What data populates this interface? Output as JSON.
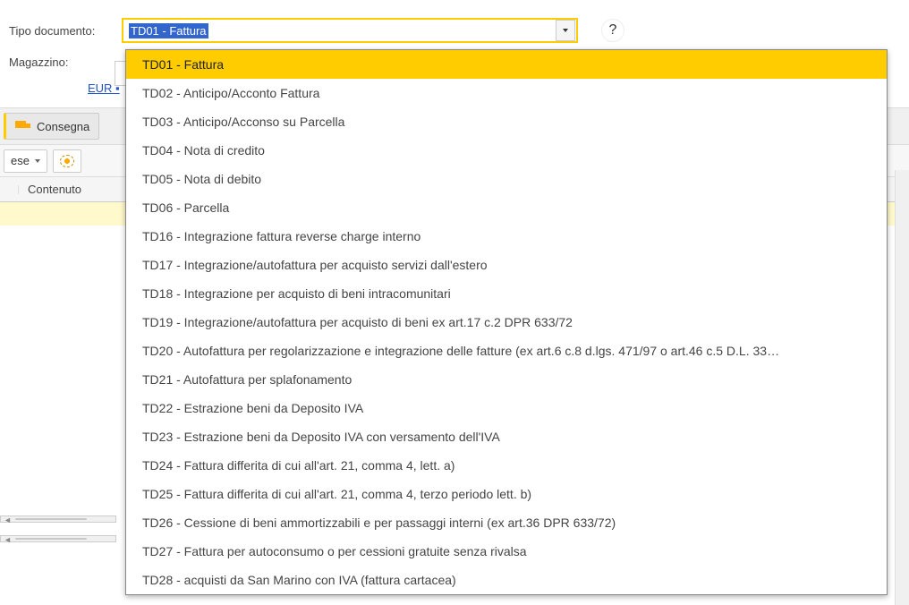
{
  "form": {
    "tipo_documento_label": "Tipo documento:",
    "tipo_documento_value": "TD01 - Fattura",
    "magazzino_label": "Magazzino:",
    "currency_link": "EUR ▪",
    "help_text": "?"
  },
  "toolbar": {
    "consegna_label": "Consegna",
    "ese_label": "ese"
  },
  "grid": {
    "col_contenuto": "Contenuto"
  },
  "dropdown": {
    "items": [
      "TD01 - Fattura",
      "TD02 - Anticipo/Acconto Fattura",
      "TD03 - Anticipo/Acconso su Parcella",
      "TD04 - Nota di credito",
      "TD05 - Nota di debito",
      "TD06 - Parcella",
      "TD16 - Integrazione fattura reverse charge interno",
      "TD17 - Integrazione/autofattura per acquisto servizi dall'estero",
      "TD18 - Integrazione per acquisto di beni intracomunitari",
      "TD19 - Integrazione/autofattura per acquisto di beni ex art.17 c.2 DPR 633/72",
      "TD20 - Autofattura per regolarizzazione e integrazione delle fatture (ex art.6 c.8 d.lgs. 471/97  o  art.46 c.5 D.L. 33…",
      "TD21 - Autofattura per splafonamento",
      "TD22 - Estrazione beni da Deposito IVA",
      "TD23 - Estrazione beni da Deposito IVA con versamento dell'IVA",
      "TD24 - Fattura differita di cui all'art. 21, comma 4, lett. a)",
      "TD25 - Fattura differita di cui all'art. 21, comma 4, terzo periodo lett. b)",
      "TD26 - Cessione di beni ammortizzabili e per passaggi interni (ex art.36 DPR 633/72)",
      "TD27 - Fattura per autoconsumo o per cessioni gratuite senza rivalsa",
      "TD28 - acquisti da San Marino con IVA (fattura cartacea)"
    ],
    "selected_index": 0
  }
}
